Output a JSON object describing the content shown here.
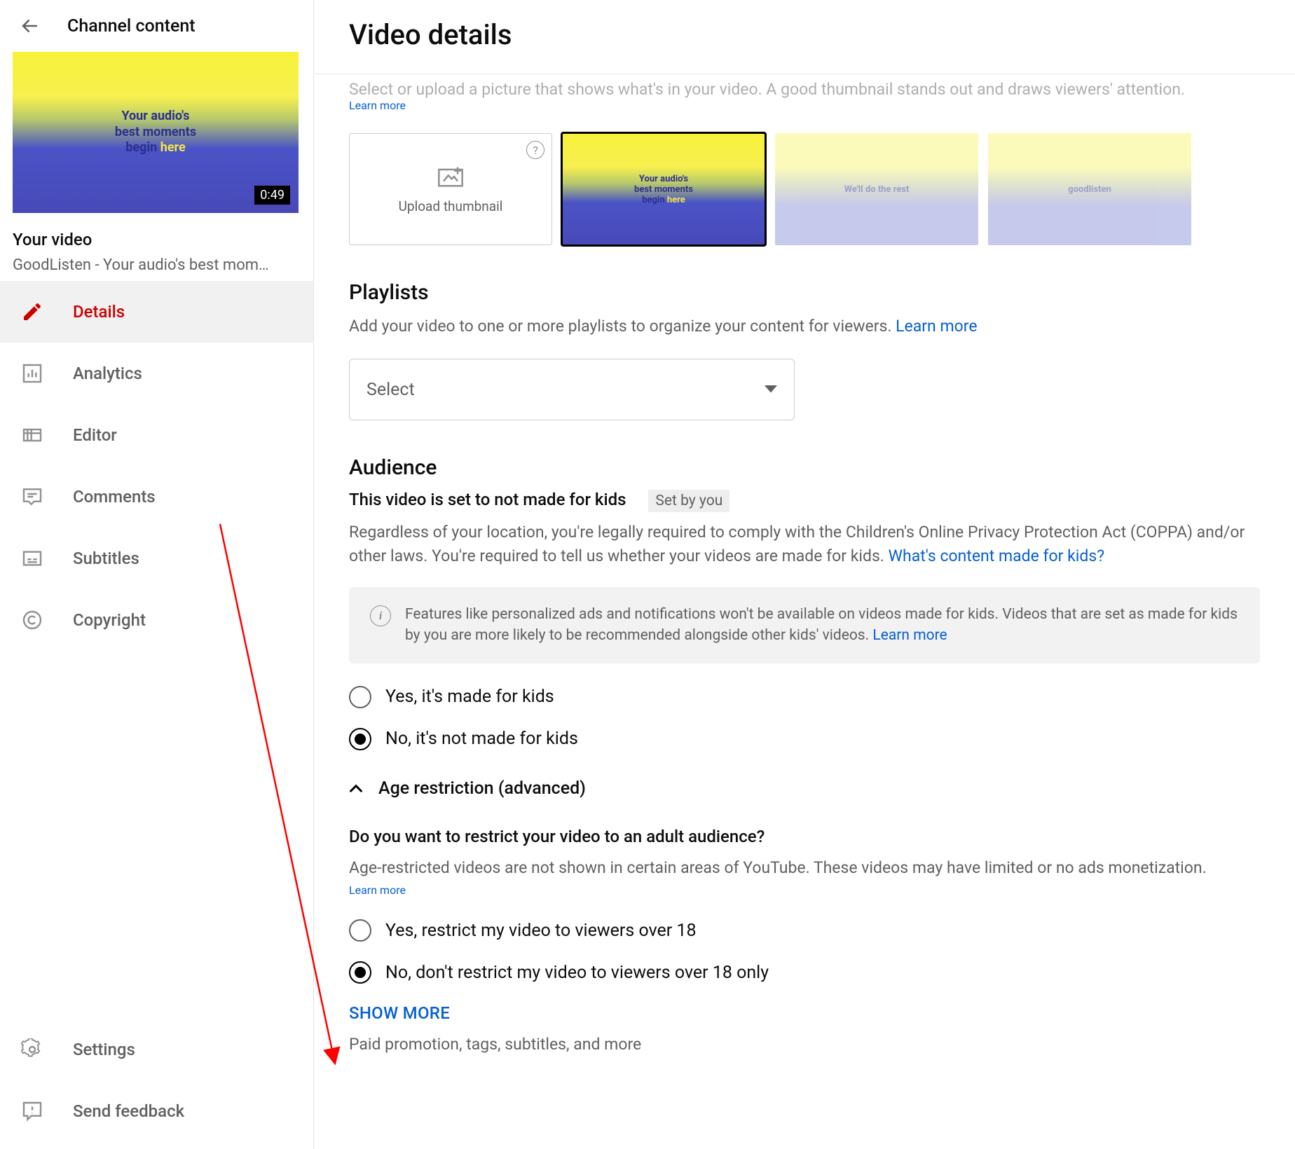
{
  "sidebar": {
    "back_label": "Channel content",
    "preview_caption_line1": "Your audio's",
    "preview_caption_line2": "best moments",
    "preview_caption_line3_a": "begin ",
    "preview_caption_line3_b": "here",
    "duration": "0:49",
    "your_video_heading": "Your video",
    "video_title": "GoodListen - Your audio's best mom…",
    "nav": {
      "details": "Details",
      "analytics": "Analytics",
      "editor": "Editor",
      "comments": "Comments",
      "subtitles": "Subtitles",
      "copyright": "Copyright",
      "settings": "Settings",
      "send_feedback": "Send feedback"
    }
  },
  "main": {
    "title": "Video details",
    "thumb_desc_cut": "Select or upload a picture that shows what's in your video. A good thumbnail stands out and draws viewers' attention.",
    "learn_more": "Learn more",
    "upload_thumb": "Upload thumbnail",
    "thumb1_l1": "Your audio's",
    "thumb1_l2": "best moments",
    "thumb1_l3a": "begin ",
    "thumb1_l3b": "here",
    "thumb2_text": "We'll do the rest",
    "thumb3_text": "goodlisten",
    "playlists": {
      "title": "Playlists",
      "desc": "Add your video to one or more playlists to organize your content for viewers. ",
      "select_label": "Select"
    },
    "audience": {
      "title": "Audience",
      "status": "This video is set to not made for kids",
      "badge": "Set by you",
      "desc": "Regardless of your location, you're legally required to comply with the Children's Online Privacy Protection Act (COPPA) and/or other laws. You're required to tell us whether your videos are made for kids. ",
      "link": "What's content made for kids?",
      "info": "Features like personalized ads and notifications won't be available on videos made for kids. Videos that are set as made for kids by you are more likely to be recommended alongside other kids' videos. ",
      "yes_kids": "Yes, it's made for kids",
      "no_kids": "No, it's not made for kids"
    },
    "age": {
      "expander": "Age restriction (advanced)",
      "question": "Do you want to restrict your video to an adult audience?",
      "desc": "Age-restricted videos are not shown in certain areas of YouTube. These videos may have limited or no ads monetization. ",
      "yes": "Yes, restrict my video to viewers over 18",
      "no": "No, don't restrict my video to viewers over 18 only"
    },
    "show_more": "SHOW MORE",
    "show_more_sub": "Paid promotion, tags, subtitles, and more"
  }
}
